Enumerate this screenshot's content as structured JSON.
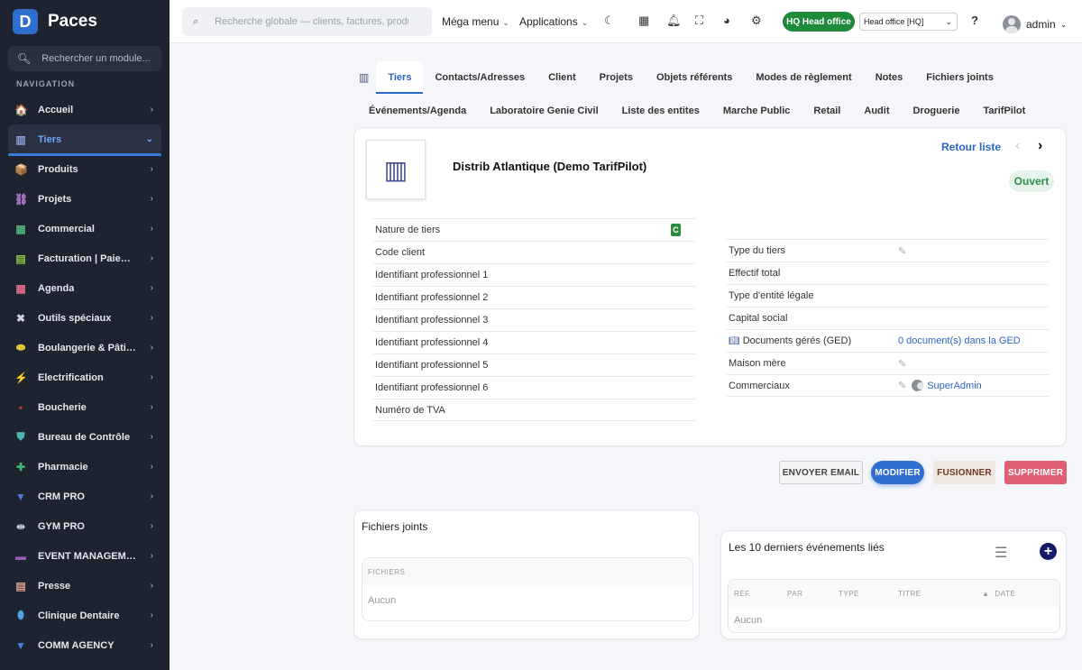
{
  "app": {
    "logo_letter": "D",
    "name": "Paces"
  },
  "sidebar": {
    "search_placeholder": "Rechercher un module...",
    "section_title": "NAVIGATION",
    "items": [
      {
        "label": "Accueil",
        "icon": "home-icon",
        "glyph": "🏠",
        "color": "#cfd3dc"
      },
      {
        "label": "Tiers",
        "icon": "building-icon",
        "glyph": "▥",
        "color": "#8f9bd6",
        "active": true
      },
      {
        "label": "Produits",
        "icon": "box-icon",
        "glyph": "📦",
        "color": "#d9a640"
      },
      {
        "label": "Projets",
        "icon": "project-icon",
        "glyph": "⛓",
        "color": "#b07bd6"
      },
      {
        "label": "Commercial",
        "icon": "shop-icon",
        "glyph": "▦",
        "color": "#4fb07a"
      },
      {
        "label": "Facturation | Paiement",
        "icon": "invoice-icon",
        "glyph": "▤",
        "color": "#8bc34a"
      },
      {
        "label": "Agenda",
        "icon": "calendar-icon",
        "glyph": "▦",
        "color": "#e06a8a"
      },
      {
        "label": "Outils spéciaux",
        "icon": "tools-icon",
        "glyph": "✖",
        "color": "#cfd3dc"
      },
      {
        "label": "Boulangerie & Pâtisserie",
        "icon": "bread-icon",
        "glyph": "⬬",
        "color": "#e3c23a"
      },
      {
        "label": "Electrification",
        "icon": "bolt-icon",
        "glyph": "⚡",
        "color": "#f0c419"
      },
      {
        "label": "Boucherie",
        "icon": "meat-icon",
        "glyph": "▪",
        "color": "#c0392b"
      },
      {
        "label": "Bureau de Contrôle",
        "icon": "shield-icon",
        "glyph": "⛊",
        "color": "#4db6ac"
      },
      {
        "label": "Pharmacie",
        "icon": "cross-icon",
        "glyph": "✚",
        "color": "#3cb371"
      },
      {
        "label": "CRM PRO",
        "icon": "funnel-icon",
        "glyph": "▼",
        "color": "#4a7fe0"
      },
      {
        "label": "GYM PRO",
        "icon": "dumbbell-icon",
        "glyph": "⇹",
        "color": "#cfd3dc"
      },
      {
        "label": "EVENT MANAGEMENT",
        "icon": "event-icon",
        "glyph": "▬",
        "color": "#9b59b6"
      },
      {
        "label": "Presse",
        "icon": "newspaper-icon",
        "glyph": "▤",
        "color": "#e0a090"
      },
      {
        "label": "Clinique Dentaire",
        "icon": "tooth-icon",
        "glyph": "⬮",
        "color": "#4aa3df"
      },
      {
        "label": "COMM AGENCY",
        "icon": "funnel-icon",
        "glyph": "▼",
        "color": "#4a7fe0"
      }
    ]
  },
  "topbar": {
    "search_placeholder": "Recherche globale — clients, factures, produits...",
    "mega_menu": "Méga menu",
    "applications": "Applications",
    "hq_badge": "HQ Head office",
    "hq_select": "Head office [HQ]",
    "user": "admin"
  },
  "tabs": {
    "row1": [
      "Tiers",
      "Contacts/Adresses",
      "Client",
      "Projets",
      "Objets référents",
      "Modes de règlement",
      "Notes",
      "Fichiers joints"
    ],
    "row2": [
      "Événements/Agenda",
      "Laboratoire Genie Civil",
      "Liste des entites",
      "Marche Public",
      "Retail",
      "Audit",
      "Droguerie",
      "TarifPilot"
    ]
  },
  "record": {
    "name": "Distrib Atlantique (Demo TarifPilot)",
    "back_label": "Retour liste",
    "status": "Ouvert",
    "nature_badge": "C",
    "left_fields": [
      "Nature de tiers",
      "Code client",
      "Identifiant professionnel 1",
      "Identifiant professionnel 2",
      "Identifiant professionnel 3",
      "Identifiant professionnel 4",
      "Identifiant professionnel 5",
      "Identifiant professionnel 6",
      "Numéro de TVA"
    ],
    "right_fields": {
      "type_tiers": "Type du tiers",
      "effectif": "Effectif total",
      "type_entite": "Type d'entité légale",
      "capital": "Capital social",
      "documents": "Documents gérés (GED)",
      "documents_value": "0 document(s) dans la GED",
      "maison_mere": "Maison mère",
      "commerciaux": "Commerciaux",
      "commerciaux_value": "SuperAdmin"
    }
  },
  "actions": {
    "email": "ENVOYER EMAIL",
    "modify": "MODIFIER",
    "merge": "FUSIONNER",
    "delete": "SUPPRIMER"
  },
  "files": {
    "title": "Fichiers joints",
    "header": "FICHIERS",
    "empty": "Aucun"
  },
  "events": {
    "title": "Les 10 derniers événements liés",
    "headers": [
      "RÉF.",
      "PAR",
      "TYPE",
      "TITRE",
      "DATE"
    ],
    "empty": "Aucun"
  }
}
